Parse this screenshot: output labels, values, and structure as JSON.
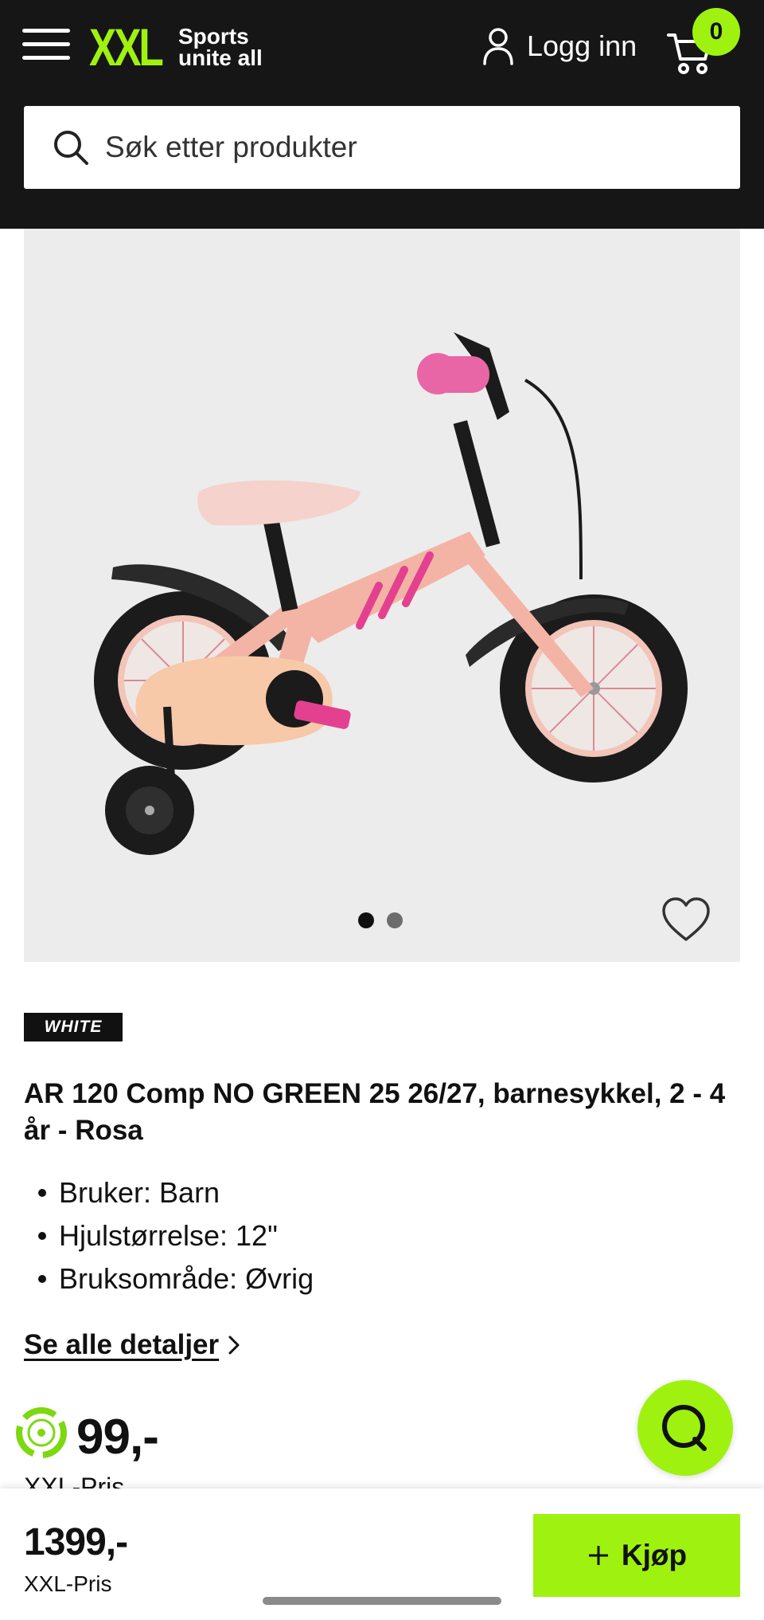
{
  "header": {
    "logo_wordmark": "XXL",
    "logo_tagline_1": "Sports",
    "logo_tagline_2": "unite all",
    "login_label": "Logg inn",
    "cart_count": "0"
  },
  "search": {
    "placeholder": "Søk etter produkter"
  },
  "gallery": {
    "image_count": 2,
    "active_index": 0
  },
  "product": {
    "brand": "WHITE",
    "title": "AR 120 Comp NO GREEN 25 26/27, barnesykkel, 2 - 4 år - Rosa",
    "specs": [
      "Bruker: Barn",
      "Hjulstørrelse: 12\"",
      "Bruksområde: Øvrig"
    ],
    "details_link": "Se alle detaljer",
    "price": "99,-",
    "price_label": "XXL-Pris"
  },
  "bottom_bar": {
    "price": "1399,-",
    "price_label": "XXL-Pris",
    "buy_label": "Kjøp"
  },
  "colors": {
    "accent": "#9ff210",
    "header_bg": "#161616",
    "gallery_bg": "#ececec",
    "frame_pink": "#f3b4a6",
    "accent_pink": "#e3418f"
  },
  "icons": {
    "menu": "hamburger-icon",
    "user": "user-icon",
    "cart": "cart-icon",
    "search": "search-icon",
    "favorite": "heart-icon",
    "details": "chevron-right-icon",
    "eco": "recycle-icon",
    "chat": "chat-icon",
    "buy": "plus-icon"
  }
}
